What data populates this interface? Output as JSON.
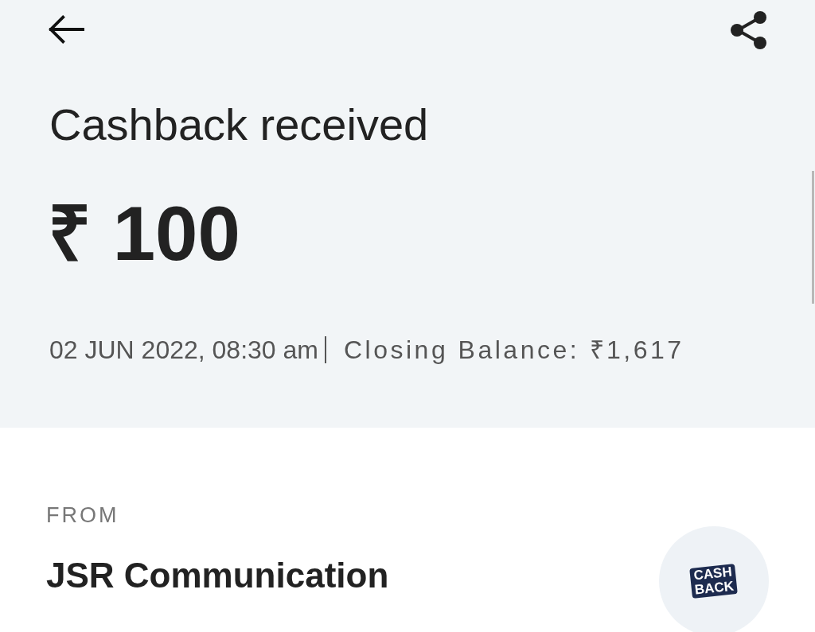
{
  "transaction": {
    "title": "Cashback received",
    "amount": "₹ 100",
    "date": "02 JUN 2022, 08:30 am",
    "closing_balance": "Closing Balance: ₹1,617"
  },
  "sender": {
    "label": "FROM",
    "name": "JSR Communication",
    "logo": {
      "lines": [
        "CASH",
        "BACK"
      ]
    }
  }
}
